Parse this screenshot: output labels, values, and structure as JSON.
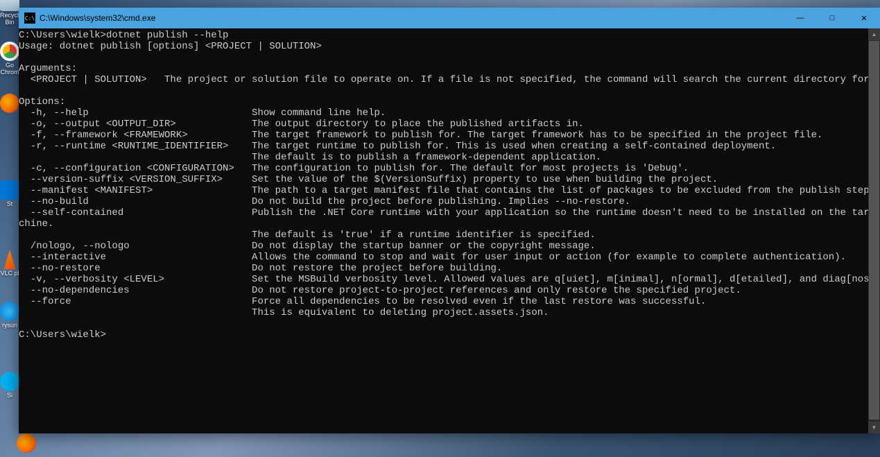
{
  "desktop": {
    "icons": [
      {
        "name": "recyclebin",
        "label": "Recycle Bin"
      },
      {
        "name": "chrome",
        "label": "Go Chrom"
      },
      {
        "name": "firefox",
        "label": ""
      },
      {
        "name": "store",
        "label": "St"
      },
      {
        "name": "vlc",
        "label": "VLC pl"
      },
      {
        "name": "ie",
        "label": "rysun"
      },
      {
        "name": "skype",
        "label": "Si"
      },
      {
        "name": "ff2",
        "label": ""
      }
    ]
  },
  "window": {
    "icon_text": "C:\\",
    "title": "C:\\Windows\\system32\\cmd.exe",
    "min": "—",
    "max": "□",
    "close": "✕"
  },
  "scroll": {
    "up": "▲",
    "down": "▼"
  },
  "terminal": {
    "lines": [
      "C:\\Users\\wielk>dotnet publish --help",
      "Usage: dotnet publish [options] <PROJECT | SOLUTION>",
      "",
      "Arguments:",
      "  <PROJECT | SOLUTION>   The project or solution file to operate on. If a file is not specified, the command will search the current directory for one.",
      "",
      "Options:",
      "  -h, --help                            Show command line help.",
      "  -o, --output <OUTPUT_DIR>             The output directory to place the published artifacts in.",
      "  -f, --framework <FRAMEWORK>           The target framework to publish for. The target framework has to be specified in the project file.",
      "  -r, --runtime <RUNTIME_IDENTIFIER>    The target runtime to publish for. This is used when creating a self-contained deployment.",
      "                                        The default is to publish a framework-dependent application.",
      "  -c, --configuration <CONFIGURATION>   The configuration to publish for. The default for most projects is 'Debug'.",
      "  --version-suffix <VERSION_SUFFIX>     Set the value of the $(VersionSuffix) property to use when building the project.",
      "  --manifest <MANIFEST>                 The path to a target manifest file that contains the list of packages to be excluded from the publish step.",
      "  --no-build                            Do not build the project before publishing. Implies --no-restore.",
      "  --self-contained                      Publish the .NET Core runtime with your application so the runtime doesn't need to be installed on the target ma",
      "chine.",
      "                                        The default is 'true' if a runtime identifier is specified.",
      "  /nologo, --nologo                     Do not display the startup banner or the copyright message.",
      "  --interactive                         Allows the command to stop and wait for user input or action (for example to complete authentication).",
      "  --no-restore                          Do not restore the project before building.",
      "  -v, --verbosity <LEVEL>               Set the MSBuild verbosity level. Allowed values are q[uiet], m[inimal], n[ormal], d[etailed], and diag[nostic].",
      "  --no-dependencies                     Do not restore project-to-project references and only restore the specified project.",
      "  --force                               Force all dependencies to be resolved even if the last restore was successful.",
      "                                        This is equivalent to deleting project.assets.json.",
      "",
      "C:\\Users\\wielk>"
    ]
  }
}
